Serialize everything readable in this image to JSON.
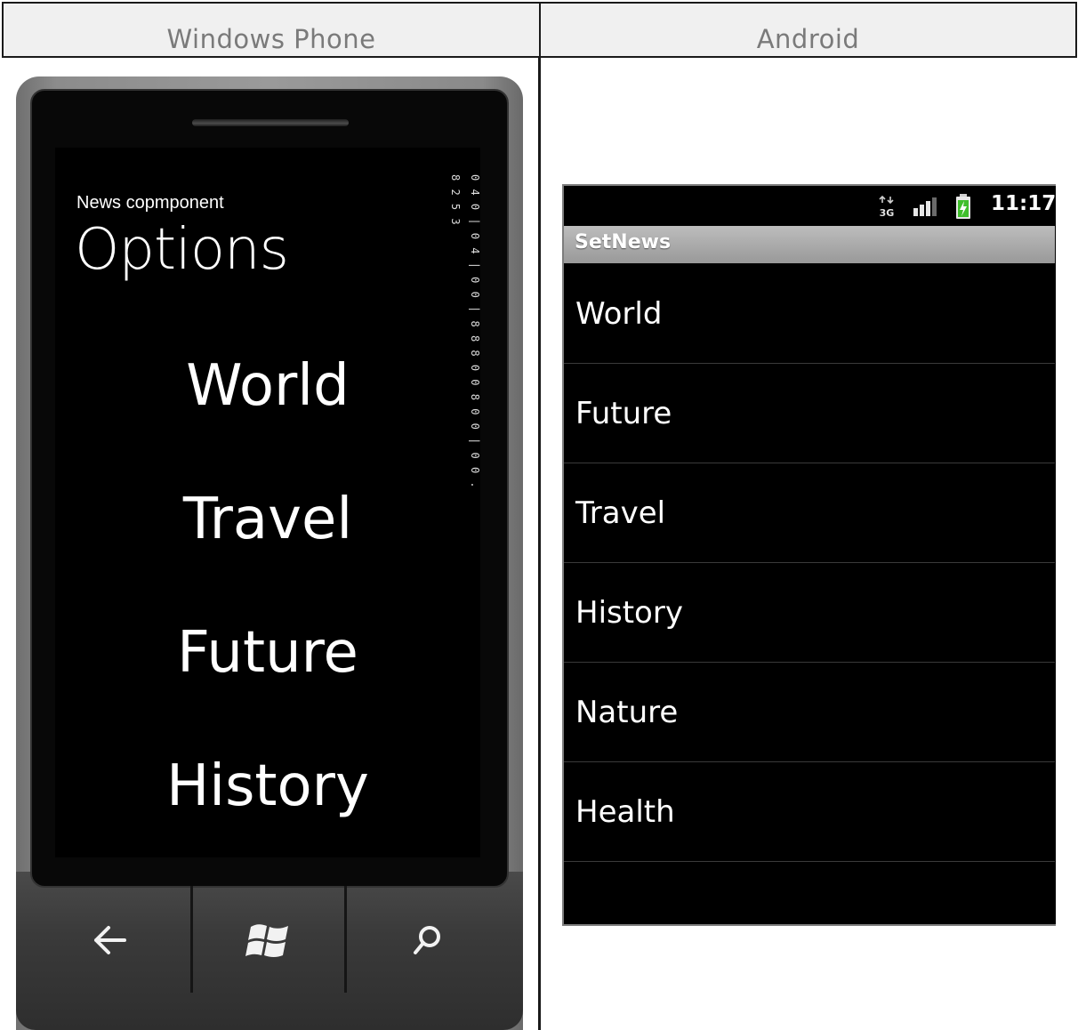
{
  "table": {
    "left_header": "Windows Phone",
    "right_header": "Android"
  },
  "windows_phone": {
    "app_name": "News copmponent",
    "page_title": "Options",
    "items": [
      "World",
      "Travel",
      "Future",
      "History"
    ],
    "frame_counter": "0 4 0 | 0 4 | 0 0 | 8 8 8   0 0 8   0 0 | 0 0 . 8 2 5 3",
    "buttons": {
      "back": "back-arrow",
      "start": "windows-logo",
      "search": "search"
    }
  },
  "android": {
    "status_time": "11:17",
    "status_network": "3G",
    "app_title": "SetNews",
    "items": [
      "World",
      "Future",
      "Travel",
      "History",
      "Nature",
      "Health"
    ]
  }
}
